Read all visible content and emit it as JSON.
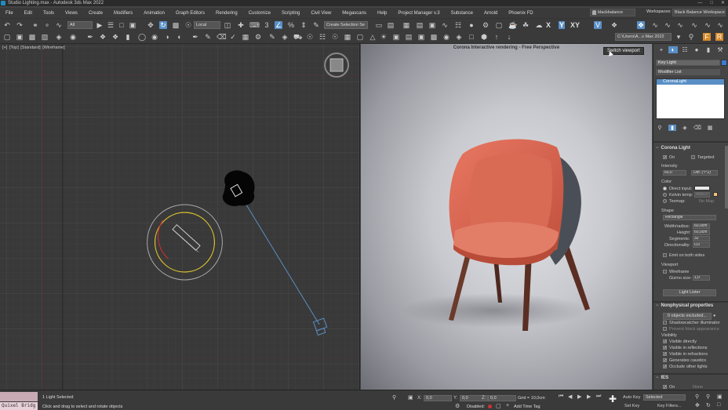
{
  "window": {
    "title": "Studio Lighting.max - Autodesk 3ds Max 2022"
  },
  "menu": {
    "items": [
      "File",
      "Edit",
      "Tools",
      "Views",
      "Create",
      "Modifiers",
      "Animation",
      "Graph Editors",
      "Rendering",
      "Customize",
      "Scripting",
      "Civil View",
      "Megascans",
      "Help",
      "Project Manager v.3",
      "Substance",
      "Arnold",
      "Phoenix FD"
    ],
    "user": "blackbalance",
    "workspaces_label": "Workspaces:",
    "workspace": "Black Balance Workspace"
  },
  "toolbar": {
    "filter": "All",
    "refcoord": "Local",
    "selection_set": "Create Selection Se",
    "path": "C:\\Users\\A...s Max 2022",
    "axis_xy": "XY",
    "axis_y": "Y",
    "axis_x": "X"
  },
  "viewport_left": {
    "labels": [
      "[+]",
      "[Top]",
      "[Standard]",
      "[Wireframe]"
    ]
  },
  "viewport_right": {
    "title": "Corona Interactive rendering - Free Perspective",
    "tooltip": "Switch viewport"
  },
  "panel": {
    "object_name": "Key Light",
    "modifier_list": "Modifier List",
    "stack_item": "CoronaLight",
    "corona_light": {
      "title": "Corona Light",
      "on_label": "On",
      "targeted_label": "Targeted",
      "intensity_label": "Intensity",
      "intensity_value": "60,0",
      "intensity_unit": "Def. (*/*2)",
      "color_label": "Color",
      "direct_input": "Direct input:",
      "kelvin_temp": "Kelvin temp:",
      "kelvin_value": "4000,0",
      "texmap": "Texmap:",
      "texmap_value": "No Map",
      "shape_label": "Shape",
      "shape_value": "Rectangle",
      "width_label": "Width/radius:",
      "width_value": "60,0cm",
      "height_label": "Height:",
      "height_value": "60,0cm",
      "segments_label": "Segments:",
      "segments_value": "32",
      "directionality_label": "Directionality:",
      "directionality_value": "0,0",
      "emit_both": "Emit on both sides",
      "viewport_label": "Viewport",
      "wireframe": "Wireframe",
      "gizmo_label": "Gizmo size:",
      "gizmo_value": "1,0",
      "light_lister": "Light Lister"
    },
    "nonphysical": {
      "title": "Nonphysical properties",
      "excluded": "0 objects excluded...",
      "shadowcatcher": "Shadowcatcher illuminator",
      "prevent": "Prevent black appearance",
      "visibility_label": "Visibility",
      "visible_directly": "Visible directly",
      "visible_reflections": "Visible in reflections",
      "visible_refractions": "Visible in refractions",
      "caustics": "Generates caustics",
      "occlude": "Occlude other lights"
    },
    "ies": {
      "title": "IES",
      "on_label": "On",
      "value": "None"
    }
  },
  "status": {
    "listener": "Quixel Bridg",
    "selected": "1 Light Selected",
    "prompt": "Click and drag to select and rotate objects",
    "x_label": "X:",
    "x_value": "0,0",
    "y_label": "Y:",
    "y_value": "0,0",
    "z_label": "Z:",
    "z_value": "0,0",
    "grid": "Grid = 10,0cm",
    "disabled": "Disabled:",
    "add_time_tag": "Add Time Tag",
    "auto_key": "Auto Key",
    "set_key": "Set Key",
    "selected_dropdown": "Selected",
    "key_filters": "Key Filters..."
  },
  "colors": {
    "accent": "#5a8fc6",
    "chair_fabric": "#d9664f",
    "chair_back": "#4a4f57"
  }
}
